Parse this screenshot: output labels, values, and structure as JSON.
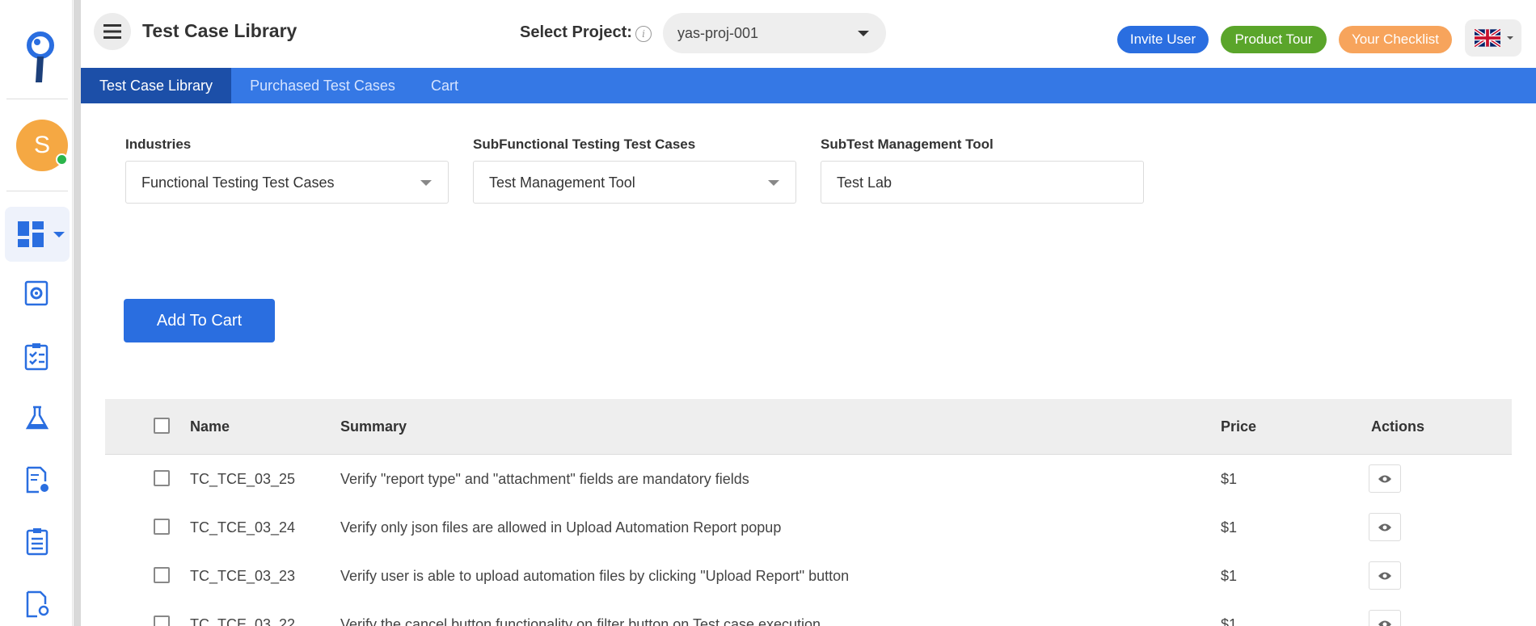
{
  "header": {
    "title": "Test Case Library",
    "select_project_label": "Select Project:",
    "info_glyph": "i",
    "project_value": "yas-proj-001",
    "invite_label": "Invite User",
    "tour_label": "Product Tour",
    "checklist_label": "Your Checklist"
  },
  "sidebar": {
    "avatar_initial": "S"
  },
  "tabs": [
    {
      "label": "Test Case Library"
    },
    {
      "label": "Purchased Test Cases"
    },
    {
      "label": "Cart"
    }
  ],
  "filters": {
    "industries_label": "Industries",
    "industries_value": "Functional Testing Test Cases",
    "sub_label": "SubFunctional Testing Test Cases",
    "sub_value": "Test Management Tool",
    "subtool_label": "SubTest Management Tool",
    "subtool_value": "Test Lab"
  },
  "add_to_cart_label": "Add To Cart",
  "table": {
    "headers": {
      "name": "Name",
      "summary": "Summary",
      "price": "Price",
      "actions": "Actions"
    },
    "rows": [
      {
        "name": "TC_TCE_03_25",
        "summary": "Verify \"report type\" and \"attachment\" fields are mandatory fields",
        "price": "$1"
      },
      {
        "name": "TC_TCE_03_24",
        "summary": "Verify only json files are allowed in Upload Automation Report popup",
        "price": "$1"
      },
      {
        "name": "TC_TCE_03_23",
        "summary": "Verify user is able to upload automation files by clicking \"Upload Report\" button",
        "price": "$1"
      },
      {
        "name": "TC_TCE_03_22",
        "summary": "Verify the cancel button functionality on filter button on Test case execution",
        "price": "$1"
      }
    ]
  },
  "colors": {
    "primary": "#2a6ee0",
    "tabbar": "#3578e5",
    "tab_active": "#1c4fa8",
    "tour": "#5aa52a",
    "checklist": "#f7a45c",
    "avatar": "#f5a843",
    "online": "#2bb54b"
  }
}
